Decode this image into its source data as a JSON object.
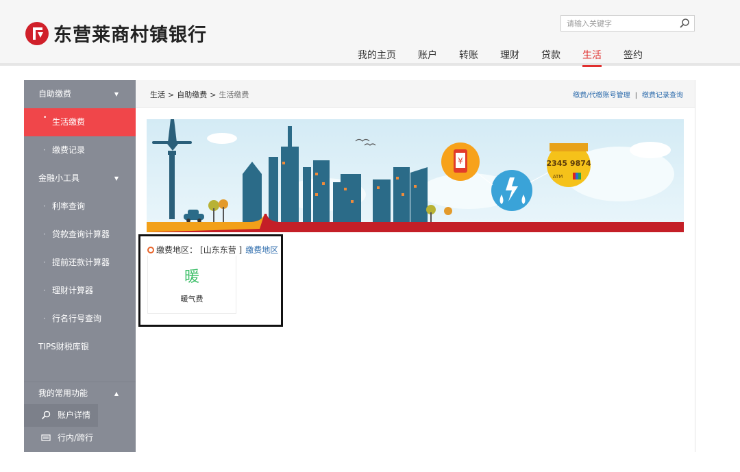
{
  "header": {
    "bank_name": "东营莱商村镇银行",
    "search_placeholder": "请输入关键字",
    "nav": [
      {
        "label": "我的主页"
      },
      {
        "label": "账户"
      },
      {
        "label": "转账"
      },
      {
        "label": "理财"
      },
      {
        "label": "贷款"
      },
      {
        "label": "生活",
        "active": true
      },
      {
        "label": "签约"
      }
    ]
  },
  "sidebar": {
    "groups": [
      {
        "label": "自助缴费",
        "items": [
          "生活缴费",
          "缴费记录"
        ]
      },
      {
        "label": "金融小工具",
        "items": [
          "利率查询",
          "贷款查询计算器",
          "提前还款计算器",
          "理财计算器",
          "行名行号查询"
        ]
      }
    ],
    "tips": "TIPS财税库银",
    "common_title": "我的常用功能",
    "common_links": [
      "账户详情",
      "行内/跨行转账"
    ]
  },
  "main": {
    "breadcrumb": [
      "生活",
      "自助缴费",
      "生活缴费"
    ],
    "toplinks": [
      "缴费/代缴账号管理",
      "缴费记录查询"
    ],
    "banner": {
      "counter_digits": "2345 9874",
      "atm_label": "ATM"
    },
    "region": {
      "label": "缴费地区：",
      "value": "[山东东营 ]",
      "link": "缴费地区"
    },
    "card": {
      "glyph": "暖",
      "label": "暖气费"
    }
  },
  "colors": {
    "accent": "#e0302f",
    "sidebar_bg": "#878b95",
    "sidebar_active": "#f0464a",
    "link": "#2f6dad",
    "card_glyph": "#3fbf6a"
  }
}
